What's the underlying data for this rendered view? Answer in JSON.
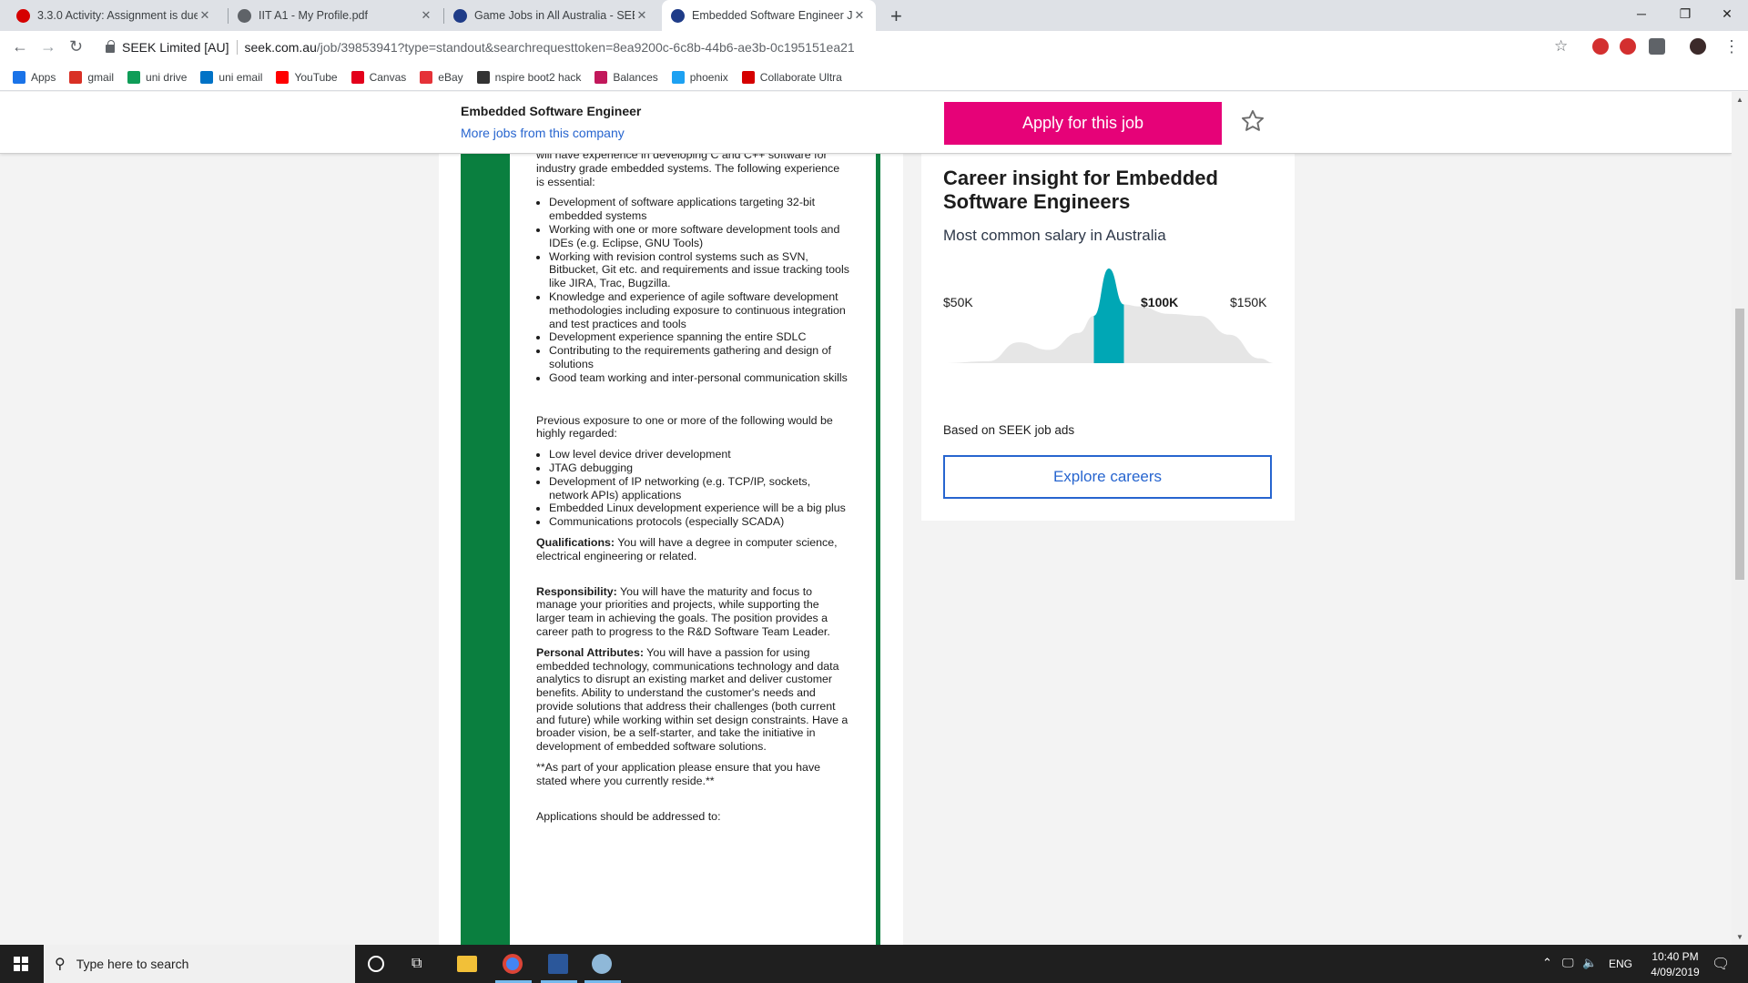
{
  "browser": {
    "tabs": [
      {
        "title": "3.3.0 Activity: Assignment is due",
        "color": "#d50000"
      },
      {
        "title": "IIT A1 - My Profile.pdf",
        "color": "#5f6368"
      },
      {
        "title": "Game Jobs in All Australia - SEEK",
        "color": "#1f3c88"
      },
      {
        "title": "Embedded Software Engineer Jo",
        "color": "#1f3c88"
      }
    ],
    "active_tab_index": 3,
    "site_identity": "SEEK Limited [AU]",
    "url_domain": "seek.com.au",
    "url_path": "/job/39853941?type=standout&searchrequesttoken=8ea9200c-6c8b-44b6-ae3b-0c195151ea21",
    "bookmarks": [
      {
        "label": "Apps",
        "icon": "apps-grid-icon",
        "color": "#1a73e8"
      },
      {
        "label": "gmail",
        "icon": "gmail-icon",
        "color": "#d93025"
      },
      {
        "label": "uni drive",
        "icon": "drive-icon",
        "color": "#0f9d58"
      },
      {
        "label": "uni email",
        "icon": "outlook-icon",
        "color": "#0072c6"
      },
      {
        "label": "YouTube",
        "icon": "youtube-icon",
        "color": "#ff0000"
      },
      {
        "label": "Canvas",
        "icon": "canvas-icon",
        "color": "#e3001b"
      },
      {
        "label": "eBay",
        "icon": "ebay-icon",
        "color": "#e53238"
      },
      {
        "label": "nspire boot2 hack",
        "icon": "github-icon",
        "color": "#333333"
      },
      {
        "label": "Balances",
        "icon": "balances-icon",
        "color": "#c2185b"
      },
      {
        "label": "phoenix",
        "icon": "phoenix-icon",
        "color": "#1da1f2"
      },
      {
        "label": "Collaborate Ultra",
        "icon": "collaborate-icon",
        "color": "#d50000"
      }
    ]
  },
  "header": {
    "job_title": "Embedded Software Engineer",
    "more_jobs_link": "More jobs from this company",
    "apply_label": "Apply for this job",
    "accent": "#e60278",
    "link_color": "#2765cf"
  },
  "job": {
    "intro": "will have experience in developing C and C++ software for industry grade embedded systems. The following experience is essential:",
    "essential": [
      "Development of software applications targeting 32-bit embedded systems",
      "Working with one or more software development tools and IDEs (e.g. Eclipse, GNU Tools)",
      "Working with revision control systems such as SVN, Bitbucket, Git etc. and requirements and issue tracking tools like JIRA, Trac, Bugzilla.",
      "Knowledge and experience of agile software development methodologies including exposure to continuous integration and test practices and tools",
      "Development experience spanning the entire SDLC",
      "Contributing to the requirements gathering and design of solutions",
      "Good team working and inter-personal communication skills"
    ],
    "previous_intro": "Previous exposure to one or more of the following would be highly regarded:",
    "previous": [
      "Low level device driver development",
      "JTAG debugging",
      "Development of IP networking (e.g. TCP/IP, sockets, network APIs) applications",
      "Embedded Linux development experience will be a big plus",
      "Communications protocols (especially SCADA)"
    ],
    "qualifications_label": "Qualifications:",
    "qualifications_text": " You will have a degree in computer science, electrical engineering or related.",
    "responsibility_label": "Responsibility:",
    "responsibility_text": " You will have the maturity and focus to manage your priorities and projects, while supporting the larger team in achieving the goals. The position provides a career path to progress to the R&D Software Team Leader.",
    "attributes_label": "Personal Attributes:",
    "attributes_text": " You will have a passion for using embedded technology, communications technology and data analytics to disrupt an existing market and deliver customer benefits. Ability to understand the customer's needs and provide solutions that address their challenges (both current and future) while working within set design constraints.  Have a broader vision, be a self-starter, and take the initiative in development of embedded software solutions.",
    "note": "**As part of your application please ensure that you have stated where you currently reside.**",
    "address": "Applications should be addressed to:",
    "brand_color": "#0a7f3f"
  },
  "career": {
    "title": "Career insight for Embedded Software Engineers",
    "subtitle": "Most common salary in Australia",
    "based_on": "Based on SEEK job ads",
    "explore_label": "Explore careers",
    "highlight_color": "#00a7b5"
  },
  "chart_data": {
    "type": "area",
    "xlabel": "",
    "ylabel": "",
    "x_ticks": [
      "$50K",
      "$100K",
      "$150K"
    ],
    "xlim": [
      45,
      155
    ],
    "highlight_range": [
      95,
      105
    ],
    "series": [
      {
        "x": [
          45,
          60,
          70,
          80,
          90,
          95,
          100,
          105,
          110,
          120,
          130,
          140,
          150,
          155
        ],
        "y": [
          0,
          0.02,
          0.22,
          0.14,
          0.32,
          0.5,
          1.0,
          0.62,
          0.6,
          0.52,
          0.5,
          0.3,
          0.05,
          0
        ]
      }
    ]
  },
  "taskbar": {
    "search_placeholder": "Type here to search",
    "language": "ENG",
    "time": "10:40 PM",
    "date": "4/09/2019"
  }
}
